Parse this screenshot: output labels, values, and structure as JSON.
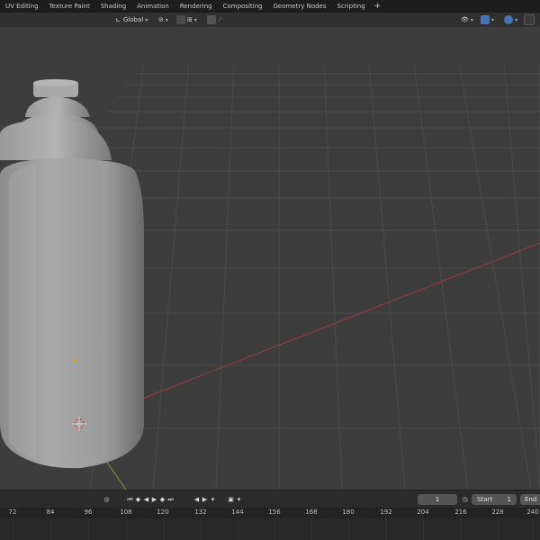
{
  "topbar": {
    "tabs": [
      "UV Editing",
      "Texture Paint",
      "Shading",
      "Animation",
      "Rendering",
      "Compositing",
      "Geometry Nodes",
      "Scripting",
      "+"
    ]
  },
  "header": {
    "transform_orientation": "Global",
    "pivot_icon": "pivot-icon",
    "snap_icon": "magnet-icon",
    "proportional_icon": "proportional-edit-icon"
  },
  "timeline": {
    "current_frame": "1",
    "start_label": "Start",
    "start_value": "1",
    "end_label": "End"
  },
  "ruler": {
    "ticks": [
      "72",
      "84",
      "96",
      "108",
      "120",
      "132",
      "144",
      "156",
      "168",
      "180",
      "192",
      "204",
      "216",
      "228",
      "240"
    ]
  },
  "colors": {
    "background": "#3d3d3d",
    "grid": "#4a4a4a",
    "x_axis": "#9c3b43",
    "y_axis": "#7f9a2b",
    "object": "#9a9a9a",
    "accent": "#4772b3"
  }
}
